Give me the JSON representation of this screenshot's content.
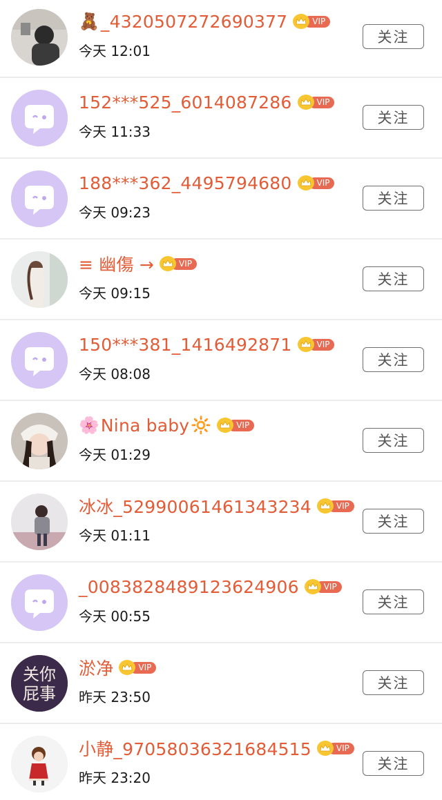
{
  "follow_label": "关注",
  "vip_label": "VIP",
  "colors": {
    "name": "#e15c37",
    "vip_badge": "#e86a52",
    "crown": "#f7c631",
    "default_avatar_bg": "#d6c6f5"
  },
  "users": [
    {
      "prefix_emoji": "🧸",
      "name": "_4320507272690377",
      "suffix_emoji": "",
      "time": "今天 12:01",
      "avatar": "photo"
    },
    {
      "prefix_emoji": "",
      "name": "152***525_6014087286",
      "suffix_emoji": "",
      "time": "今天 11:33",
      "avatar": "default"
    },
    {
      "prefix_emoji": "",
      "name": "188***362_4495794680",
      "suffix_emoji": "",
      "time": "今天 09:23",
      "avatar": "default"
    },
    {
      "prefix_emoji": "",
      "name": "≡ 幽傷 →",
      "suffix_emoji": "",
      "time": "今天 09:15",
      "avatar": "photo"
    },
    {
      "prefix_emoji": "",
      "name": "150***381_1416492871",
      "suffix_emoji": "",
      "time": "今天 08:08",
      "avatar": "default"
    },
    {
      "prefix_emoji": "🌸",
      "name": "Nina baby",
      "suffix_emoji": "🔆",
      "time": "今天 01:29",
      "avatar": "photo"
    },
    {
      "prefix_emoji": "",
      "name": "冰冰_52990061461343234",
      "suffix_emoji": "",
      "time": "今天 01:11",
      "avatar": "photo"
    },
    {
      "prefix_emoji": "",
      "name": "_0083828489123624906",
      "suffix_emoji": "",
      "time": "今天 00:55",
      "avatar": "default"
    },
    {
      "prefix_emoji": "",
      "name": "淤净",
      "suffix_emoji": "",
      "time": "昨天 23:50",
      "avatar": "text-logo",
      "avatar_text": [
        "关你",
        "屁事"
      ]
    },
    {
      "prefix_emoji": "",
      "name": "小静_97058036321684515",
      "suffix_emoji": "",
      "time": "昨天 23:20",
      "avatar": "photo"
    }
  ]
}
